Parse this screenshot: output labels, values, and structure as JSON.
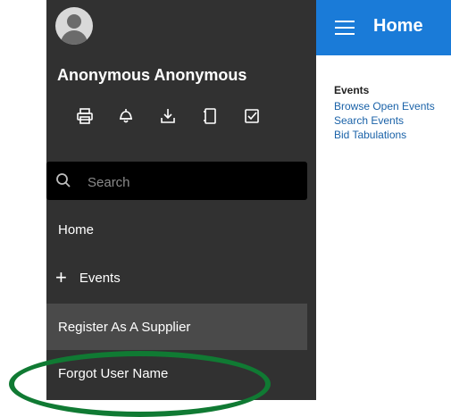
{
  "user": {
    "name": "Anonymous Anonymous"
  },
  "toolbar": {
    "icons": [
      "print-icon",
      "bell-icon",
      "download-icon",
      "notebook-icon",
      "checkbox-icon"
    ]
  },
  "search": {
    "placeholder": "Search"
  },
  "nav": {
    "items": [
      {
        "label": "Home"
      },
      {
        "label": "Events",
        "icon": "plus-icon"
      },
      {
        "label": "Register As A Supplier"
      },
      {
        "label": "Forgot User Name"
      }
    ]
  },
  "header": {
    "title": "Home"
  },
  "content": {
    "section_title": "Events",
    "links": [
      {
        "label": "Browse Open Events"
      },
      {
        "label": "Search Events"
      },
      {
        "label": "Bid Tabulations"
      }
    ]
  },
  "colors": {
    "sidebar_bg": "#313131",
    "header_bg": "#1a7bd8",
    "active_item_bg": "#4a4a4a",
    "annotation_ellipse": "#107a33"
  }
}
